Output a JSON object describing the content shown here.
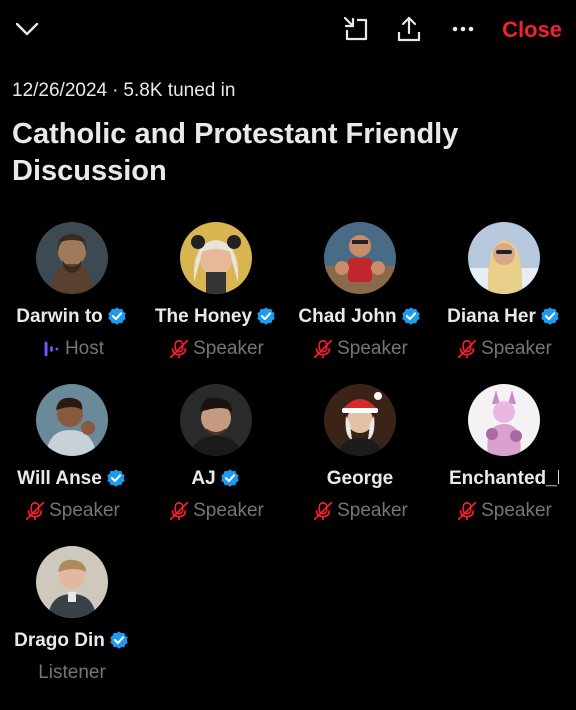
{
  "topbar": {
    "collapse_icon": "chevron-down-icon",
    "minimize_icon": "minimize-icon",
    "share_icon": "share-icon",
    "more_icon": "more-icon",
    "close_label": "Close"
  },
  "space": {
    "date": "12/26/2024",
    "separator": "·",
    "tuned_in": "5.8K tuned in",
    "title": "Catholic and Protestant Friendly Discussion"
  },
  "colors": {
    "accent_red": "#f4212e",
    "verified_blue": "#1d9bf0",
    "host_purple": "#7856ff",
    "muted_red": "#f4212e",
    "secondary_text": "#71767b"
  },
  "participants": [
    {
      "name": "Darwin to",
      "role": "Host",
      "verified": true,
      "role_icon": "host-audio-icon"
    },
    {
      "name": "The Honey",
      "role": "Speaker",
      "verified": true,
      "role_icon": "mic-off-icon"
    },
    {
      "name": "Chad John",
      "role": "Speaker",
      "verified": true,
      "role_icon": "mic-off-icon"
    },
    {
      "name": "Diana Her",
      "role": "Speaker",
      "verified": true,
      "role_icon": "mic-off-icon"
    },
    {
      "name": "Will Anse",
      "role": "Speaker",
      "verified": true,
      "role_icon": "mic-off-icon"
    },
    {
      "name": "AJ",
      "role": "Speaker",
      "verified": true,
      "role_icon": "mic-off-icon"
    },
    {
      "name": "George",
      "role": "Speaker",
      "verified": false,
      "role_icon": "mic-off-icon"
    },
    {
      "name": "Enchanted_h",
      "role": "Speaker",
      "verified": false,
      "role_icon": "mic-off-icon"
    },
    {
      "name": "Drago Din",
      "role": "Listener",
      "verified": true,
      "role_icon": ""
    }
  ]
}
